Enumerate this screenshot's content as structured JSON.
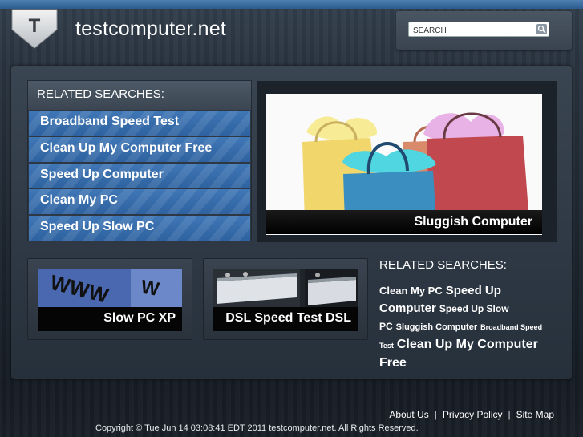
{
  "header": {
    "logo_letter": "T",
    "site_title": "testcomputer.net",
    "search_placeholder": "SEARCH"
  },
  "left_panel": {
    "heading": "RELATED SEARCHES:",
    "links": [
      "Broadband Speed Test",
      "Clean Up My Computer Free",
      "Speed Up Computer",
      "Clean My PC",
      "Speed Up Slow PC"
    ]
  },
  "hero": {
    "caption": "Sluggish Computer"
  },
  "thumbs": [
    {
      "caption": "Slow PC XP",
      "image_text": "WWW"
    },
    {
      "caption": "DSL Speed Test DSL"
    }
  ],
  "right_related": {
    "heading": "RELATED SEARCHES:",
    "tags": [
      {
        "label": "Clean My PC",
        "size": 13
      },
      {
        "label": "Speed Up Computer",
        "size": 15
      },
      {
        "label": "Speed Up Slow PC",
        "size": 12
      },
      {
        "label": "Sluggish Computer",
        "size": 11
      },
      {
        "label": "Broadband Speed Test",
        "size": 9
      },
      {
        "label": "Clean Up My Computer Free",
        "size": 16
      }
    ]
  },
  "footer": {
    "links": [
      "About Us",
      "Privacy Policy",
      "Site Map"
    ],
    "separator": "|",
    "copyright": "Copyright © Tue Jun 14 03:08:41 EDT 2011 testcomputer.net. All Rights Reserved."
  },
  "colors": {
    "accent_blue": "#3a70b0",
    "topbar": "#3d6e9f",
    "panel": "#2e3844"
  }
}
